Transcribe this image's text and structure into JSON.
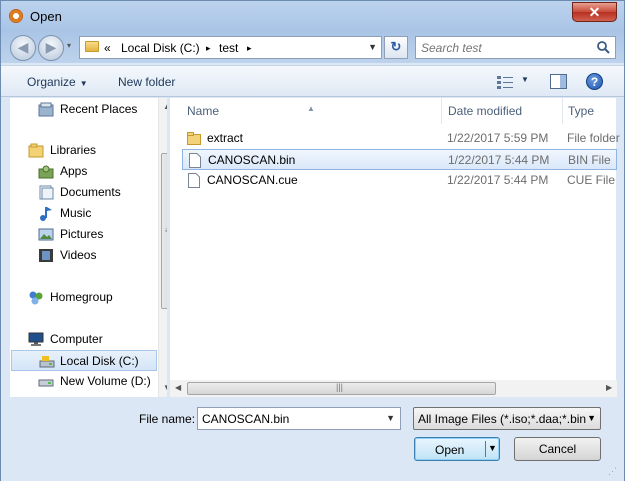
{
  "window": {
    "title": "Open",
    "close_glyph": "✕"
  },
  "nav": {
    "back_glyph": "◀",
    "forward_glyph": "▶",
    "recent_glyph": "▾",
    "address": {
      "prefix": "«",
      "segments": [
        "Local Disk (C:)",
        "test"
      ],
      "separator": "▸"
    },
    "refresh_glyph": "↻",
    "search_placeholder": "Search test"
  },
  "toolbar": {
    "organize_label": "Organize",
    "newfolder_label": "New folder",
    "dd_glyph": "▼"
  },
  "sidebar": {
    "items": [
      {
        "label": "Recent Places",
        "icon": "recent-places-icon"
      },
      {
        "label": "Libraries",
        "icon": "libraries-icon"
      },
      {
        "label": "Apps",
        "icon": "apps-icon"
      },
      {
        "label": "Documents",
        "icon": "documents-icon"
      },
      {
        "label": "Music",
        "icon": "music-icon"
      },
      {
        "label": "Pictures",
        "icon": "pictures-icon"
      },
      {
        "label": "Videos",
        "icon": "videos-icon"
      },
      {
        "label": "Homegroup",
        "icon": "homegroup-icon"
      },
      {
        "label": "Computer",
        "icon": "computer-icon"
      },
      {
        "label": "Local Disk (C:)",
        "icon": "drive-icon",
        "selected": true
      },
      {
        "label": "New Volume (D:)",
        "icon": "drive-icon"
      }
    ]
  },
  "filelist": {
    "columns": [
      "Name",
      "Date modified",
      "Type"
    ],
    "rows": [
      {
        "name": "extract",
        "date": "1/22/2017 5:59 PM",
        "type": "File folder",
        "icon": "folder-icon"
      },
      {
        "name": "CANOSCAN.bin",
        "date": "1/22/2017 5:44 PM",
        "type": "BIN File",
        "icon": "file-icon",
        "selected": true
      },
      {
        "name": "CANOSCAN.cue",
        "date": "1/22/2017 5:44 PM",
        "type": "CUE File",
        "icon": "file-icon"
      }
    ]
  },
  "footer": {
    "filename_label": "File name:",
    "filename_value": "CANOSCAN.bin",
    "filter_value": "All Image Files (*.iso;*.daa;*.bin",
    "open_label": "Open",
    "cancel_label": "Cancel"
  },
  "colors": {
    "selection": "#d9e8fa",
    "accent": "#3c7fb1",
    "close": "#c74a3a"
  }
}
